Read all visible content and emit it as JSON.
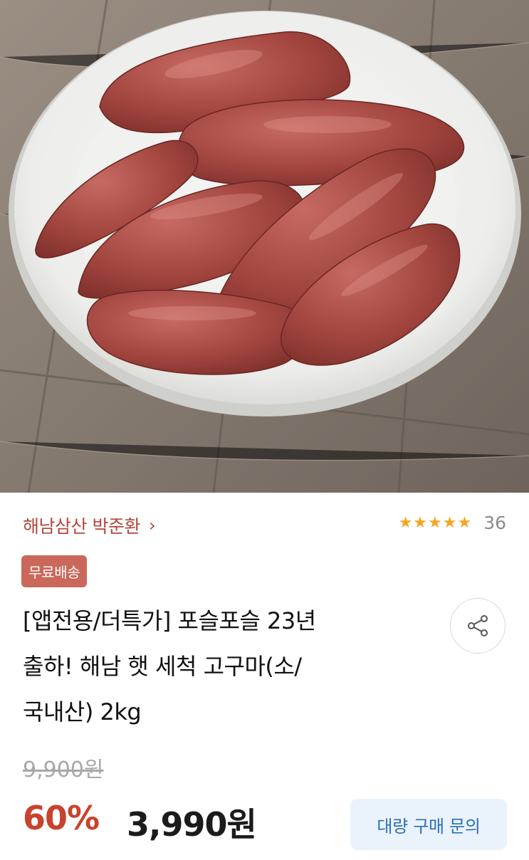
{
  "product_image": {
    "alt": "sweet-potatoes-on-plate"
  },
  "seller": {
    "name": "해남삼산 박준환",
    "chevron": "›"
  },
  "rating": {
    "stars": "★★★★★",
    "count": "36",
    "star_color": "#f5a623"
  },
  "badge": {
    "label": "무료배송",
    "color": "#c9685b"
  },
  "product": {
    "title_lines": [
      "[앱전용/더특가] 포슬포슬 23년",
      "출하! 해남 햇 세척 고구마(소/",
      "국내산) 2kg"
    ]
  },
  "price": {
    "original": "9,900원",
    "discount": "60%",
    "sale": "3,990원",
    "discount_color": "#c8432d"
  },
  "actions": {
    "share_icon": "share-icon",
    "bulk_inquiry": "대량 구매 문의"
  }
}
